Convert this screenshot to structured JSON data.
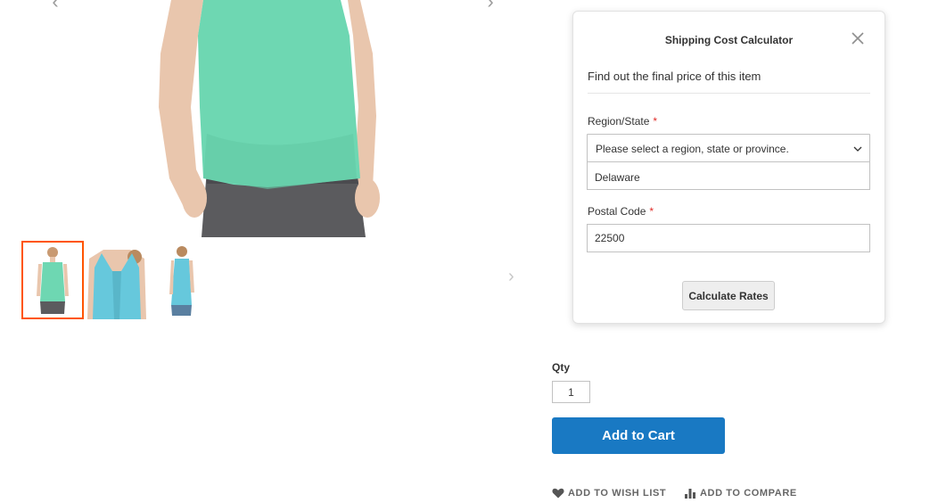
{
  "gallery": {
    "prev_arrow": "‹",
    "next_arrow": "›",
    "thumbs_next_arrow": "›",
    "active_border_color": "#ff5501",
    "shirt_color_main": "#6ed7b2",
    "shirt_color_alt": "#66c8dc"
  },
  "popup": {
    "title": "Shipping Cost Calculator",
    "subtitle": "Find out the final price of this item",
    "region_label": "Region/State",
    "region_required": "*",
    "region_placeholder": "Please select a region, state or province.",
    "region_option": "Delaware",
    "postal_label": "Postal Code",
    "postal_required": "*",
    "postal_value": "22500",
    "calculate_label": "Calculate Rates"
  },
  "product": {
    "qty_label": "Qty",
    "qty_value": "1",
    "add_to_cart_label": "Add to Cart",
    "wishlist_label": "ADD TO WISH LIST",
    "compare_label": "ADD TO COMPARE",
    "accent_color": "#1979c3"
  }
}
